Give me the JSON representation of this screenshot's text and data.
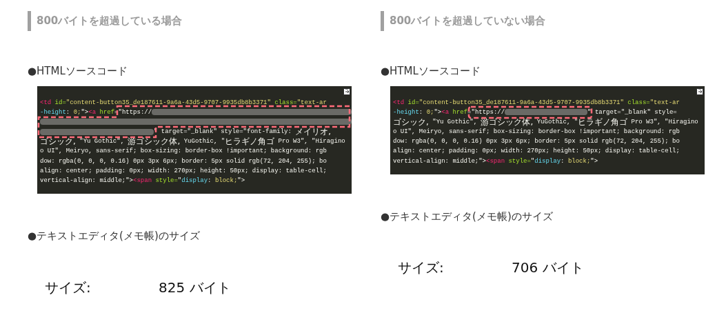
{
  "sections": [
    {
      "heading": "800バイトを超過している場合",
      "code_label": "●HTMLソースコード",
      "outline": {
        "kind": "multiline"
      },
      "code_lines": [
        [
          {
            "kind": "tag",
            "s": "<td"
          },
          {
            "kind": "attr",
            "s": " id="
          },
          {
            "kind": "string",
            "s": "\"content-button35_de187611-9a6a-43d5-9707-9935db8b3371\""
          },
          {
            "kind": "attr",
            "s": " class="
          },
          {
            "kind": "string",
            "s": "\"text-ar"
          }
        ],
        [
          {
            "kind": "prop",
            "s": "-height"
          },
          {
            "kind": "plain",
            "s": ": "
          },
          {
            "kind": "string",
            "s": "0;"
          },
          {
            "kind": "plain",
            "s": "\">"
          },
          {
            "kind": "tag",
            "s": "<a"
          },
          {
            "kind": "attr",
            "s": " href"
          },
          {
            "kind": "plain",
            "s": "=\"https://"
          },
          {
            "kind": "blurfill"
          }
        ],
        [
          {
            "kind": "blurfill"
          }
        ],
        [
          {
            "kind": "blurlong"
          },
          {
            "kind": "plain",
            "s": "\" target=\"_blank\" style=\"font-family: "
          },
          {
            "kind": "cjk",
            "s": "メイリオ,"
          }
        ],
        [
          {
            "kind": "cjk",
            "s": "ゴシック,"
          },
          {
            "kind": "plain",
            "s": " \"Yu Gothic\", "
          },
          {
            "kind": "cjk",
            "s": "游ゴシック体,"
          },
          {
            "kind": "plain",
            "s": " YuGothic, \""
          },
          {
            "kind": "cjk",
            "s": "ヒラギノ角ゴ"
          },
          {
            "kind": "plain",
            "s": " Pro W3\", \"Hiragino"
          }
        ],
        [
          {
            "kind": "plain",
            "s": "o UI\", Meiryo, sans-serif; box-sizing: border-box !important; background: rgb"
          }
        ],
        [
          {
            "kind": "plain",
            "s": "dow: rgba(0, 0, 0, 0.16) 0px 3px 6px; border: 5px solid rgb(72, 204, 255); bo"
          }
        ],
        [
          {
            "kind": "plain",
            "s": "align: center; padding: 0px; width: 270px; height: 50px; display: table-cell;"
          }
        ],
        [
          {
            "kind": "plain",
            "s": "vertical-align: middle;\">"
          },
          {
            "kind": "tag",
            "s": "<span"
          },
          {
            "kind": "attr",
            "s": " style="
          },
          {
            "kind": "plain",
            "s": "\""
          },
          {
            "kind": "prop",
            "s": "display"
          },
          {
            "kind": "plain",
            "s": ": "
          },
          {
            "kind": "string",
            "s": "block;"
          },
          {
            "kind": "plain",
            "s": "\">"
          }
        ]
      ],
      "size_label": "●テキストエディタ(メモ帳)のサイズ",
      "size_key": "サイズ:",
      "size_value": "825 バイト"
    },
    {
      "heading": "800バイトを超過していない場合",
      "code_label": "●HTMLソースコード",
      "outline": {
        "kind": "single"
      },
      "code_lines": [
        [
          {
            "kind": "tag",
            "s": "<td"
          },
          {
            "kind": "attr",
            "s": " id="
          },
          {
            "kind": "string",
            "s": "\"content-button35_de187611-9a6a-43d5-9707-9935db8b3371\""
          },
          {
            "kind": "attr",
            "s": " class="
          },
          {
            "kind": "string",
            "s": "\"text-ar"
          }
        ],
        [
          {
            "kind": "prop",
            "s": "-height"
          },
          {
            "kind": "plain",
            "s": ": "
          },
          {
            "kind": "string",
            "s": "0;"
          },
          {
            "kind": "plain",
            "s": "\">"
          },
          {
            "kind": "tag",
            "s": "<a"
          },
          {
            "kind": "attr",
            "s": " href"
          },
          {
            "kind": "plain",
            "s": "=\"https://"
          },
          {
            "kind": "blurshort"
          },
          {
            "kind": "plain",
            "s": "\" target=\"_blank\" style="
          }
        ],
        [
          {
            "kind": "cjk",
            "s": "ゴシック,"
          },
          {
            "kind": "plain",
            "s": " \"Yu Gothic\", "
          },
          {
            "kind": "cjk",
            "s": "游ゴシック体,"
          },
          {
            "kind": "plain",
            "s": " YuGothic, \""
          },
          {
            "kind": "cjk",
            "s": "ヒラギノ角ゴ"
          },
          {
            "kind": "plain",
            "s": " Pro W3\", \"Hiragino"
          }
        ],
        [
          {
            "kind": "plain",
            "s": "o UI\", Meiryo, sans-serif; box-sizing: border-box !important; background: rgb"
          }
        ],
        [
          {
            "kind": "plain",
            "s": "dow: rgba(0, 0, 0, 0.16) 0px 3px 6px; border: 5px solid rgb(72, 204, 255); bo"
          }
        ],
        [
          {
            "kind": "plain",
            "s": "align: center; padding: 0px; width: 270px; height: 50px; display: table-cell;"
          }
        ],
        [
          {
            "kind": "plain",
            "s": "vertical-align: middle;\">"
          },
          {
            "kind": "tag",
            "s": "<span"
          },
          {
            "kind": "attr",
            "s": " style="
          },
          {
            "kind": "plain",
            "s": "\""
          },
          {
            "kind": "prop",
            "s": "display"
          },
          {
            "kind": "plain",
            "s": ": "
          },
          {
            "kind": "string",
            "s": "block;"
          },
          {
            "kind": "plain",
            "s": "\">"
          }
        ]
      ],
      "size_label": "●テキストエディタ(メモ帳)のサイズ",
      "size_key": "サイズ:",
      "size_value": "706 バイト"
    }
  ]
}
